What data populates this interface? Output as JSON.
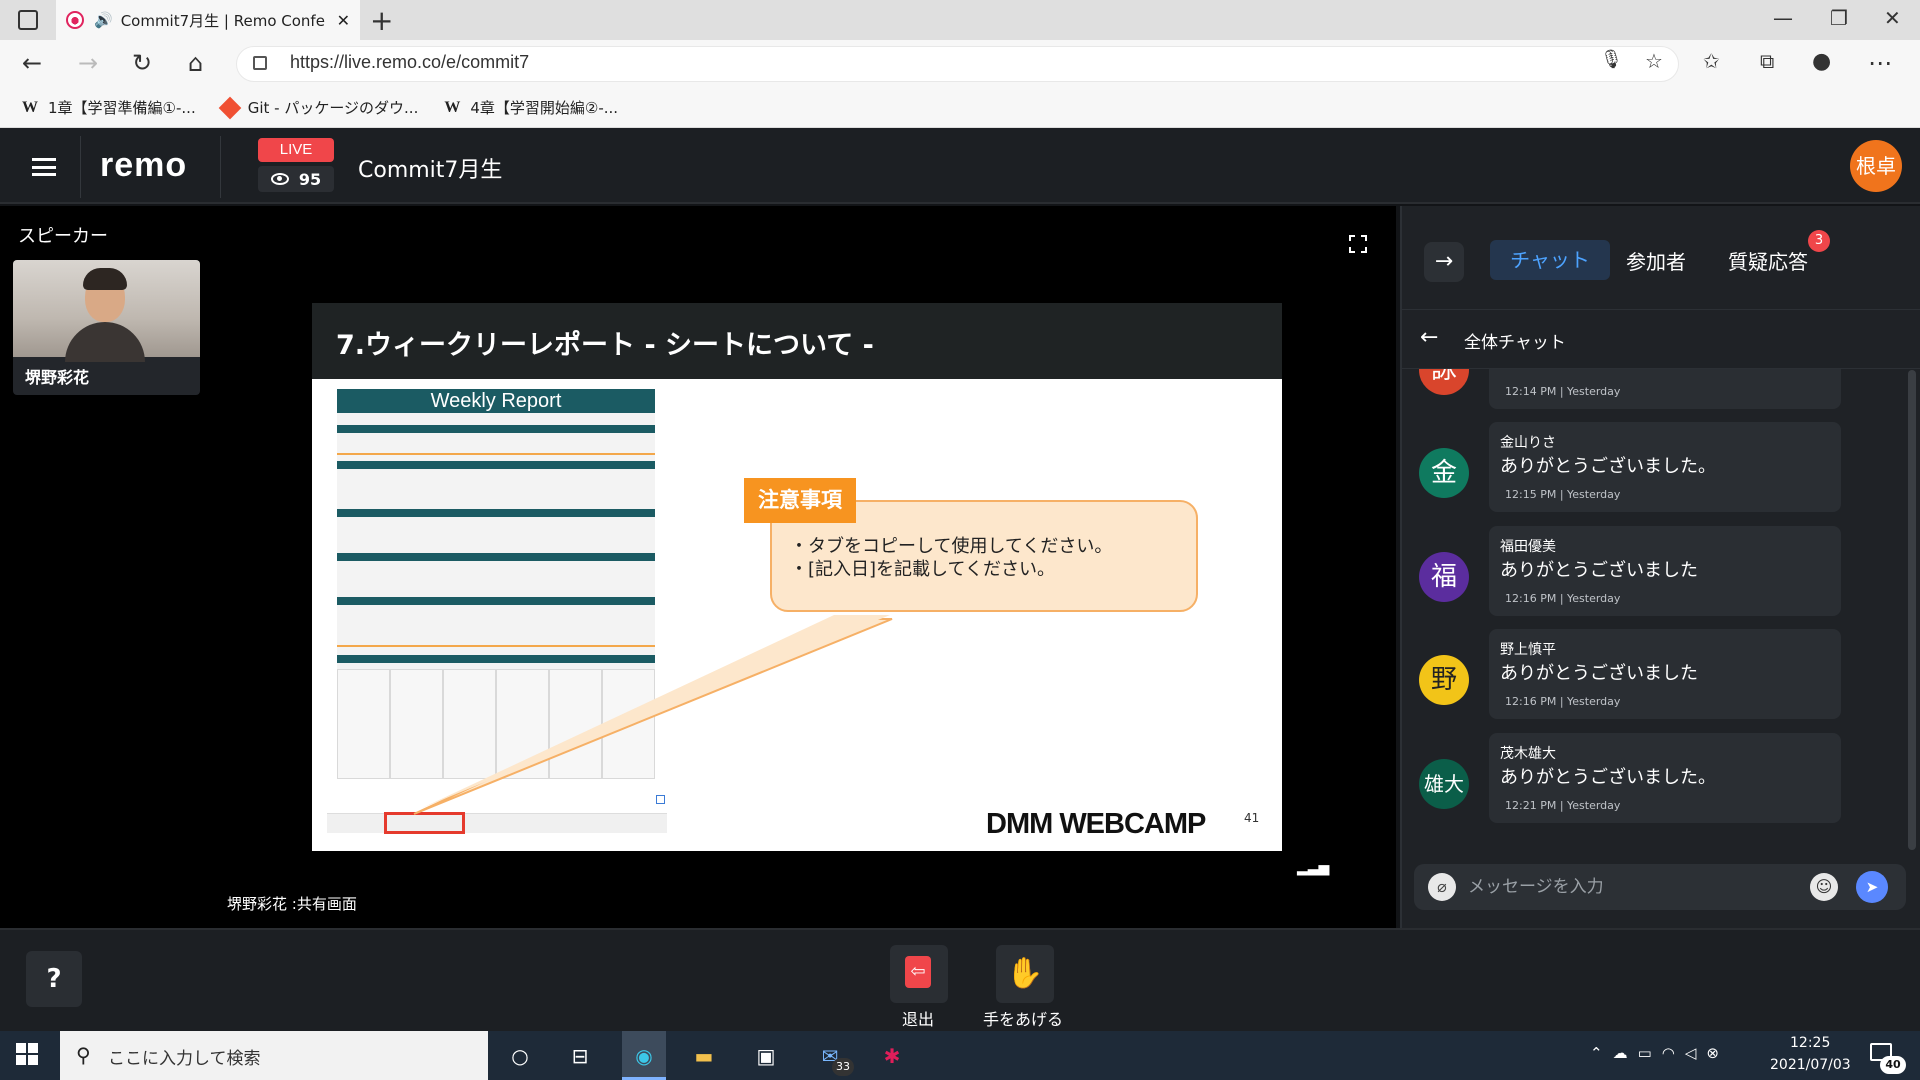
{
  "browser": {
    "tab_title": "Commit7月生 | Remo Confe",
    "url": "https://live.remo.co/e/commit7",
    "bookmarks": [
      "1章【学習準備編①-...",
      "Git - パッケージのダウ...",
      "4章【学習開始編②-..."
    ]
  },
  "remo": {
    "logo": "remo",
    "live_label": "LIVE",
    "viewer_count": "95",
    "event_title": "Commit7月生",
    "user_avatar": "根卓",
    "brand_color": "#f0464a"
  },
  "stage": {
    "speaker_section": "スピーカー",
    "speaker_name": "堺野彩花",
    "share_caption": "堺野彩花 :共有画面",
    "signal_icon": "signal-bars-icon"
  },
  "slide": {
    "title": "7.ウィークリーレポート - シートについて -",
    "report_title": "Weekly Report",
    "caution_label": "注意事項",
    "note_line1": "・タブをコピーして使用してください。",
    "note_line2": "・[記入日]を記載してください。",
    "brand": "DMM WEBCAMP",
    "page_number": "41"
  },
  "panel": {
    "tabs": {
      "chat": "チャット",
      "participants": "参加者",
      "qa": "質疑応答"
    },
    "qa_badge": "3",
    "chat_title": "全体チャット",
    "messages": [
      {
        "avatar": "詠",
        "sender": "",
        "text": "",
        "time": "12:14 PM | Yesterday",
        "color": "#d9452c"
      },
      {
        "avatar": "金",
        "sender": "金山りさ",
        "text": "ありがとうございました。",
        "time": "12:15 PM | Yesterday",
        "color": "#0f7a5f"
      },
      {
        "avatar": "福",
        "sender": "福田優美",
        "text": "ありがとうございました",
        "time": "12:16 PM | Yesterday",
        "color": "#5b2d9e"
      },
      {
        "avatar": "野",
        "sender": "野上慎平",
        "text": "ありがとうございました",
        "time": "12:16 PM | Yesterday",
        "color": "#f2c418"
      },
      {
        "avatar": "雄大",
        "sender": "茂木雄大",
        "text": "ありがとうございました。",
        "time": "12:21 PM | Yesterday",
        "color": "#0b5e49"
      }
    ],
    "message_placeholder": "メッセージを入力"
  },
  "controls": {
    "exit_label": "退出",
    "raise_hand_label": "手をあげる"
  },
  "taskbar": {
    "search_placeholder": "ここに入力して検索",
    "mail_badge": "33",
    "time": "12:25",
    "date": "2021/07/03",
    "notification_count": "40"
  }
}
